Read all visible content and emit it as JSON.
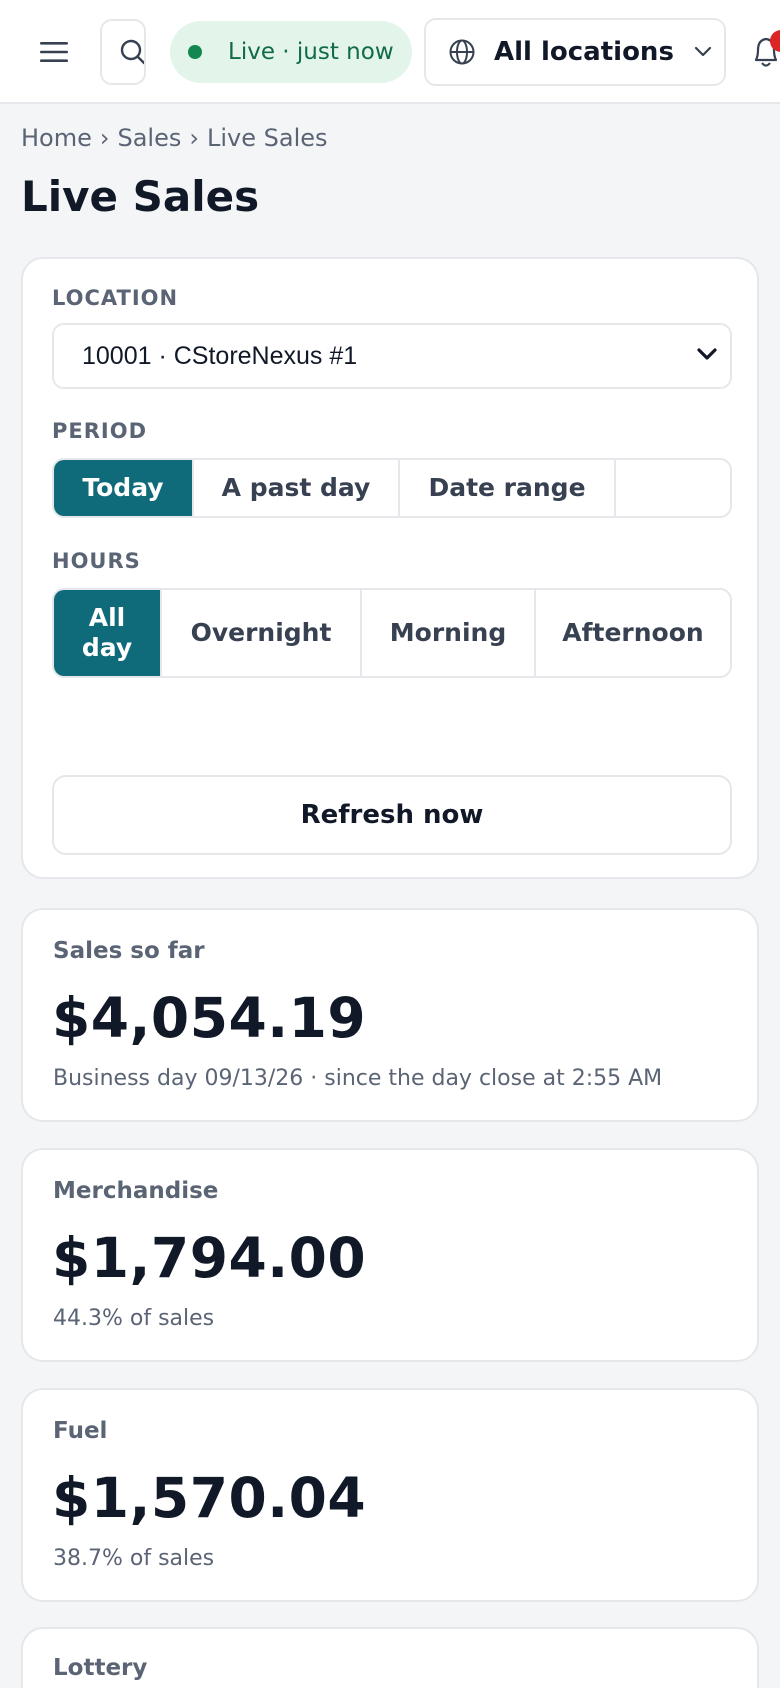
{
  "header": {
    "live_status": "Live · just now",
    "location_selector": "All locations"
  },
  "breadcrumb": [
    "Home",
    "Sales",
    "Live Sales"
  ],
  "page_title": "Live Sales",
  "filters": {
    "location_label": "LOCATION",
    "location_value": "10001 · CStoreNexus #1",
    "period_label": "PERIOD",
    "period_options": [
      "Today",
      "A past day",
      "Date range"
    ],
    "period_selected": "Today",
    "hours_label": "HOURS",
    "hours_options": [
      "All day",
      "Overnight",
      "Morning",
      "Afternoon"
    ],
    "hours_selected": "All day",
    "refresh_label": "Refresh now"
  },
  "metrics": [
    {
      "label": "Sales so far",
      "value": "$4,054.19",
      "sub": "Business day 09/13/26 · since the day close at 2:55 AM"
    },
    {
      "label": "Merchandise",
      "value": "$1,794.00",
      "sub": "44.3% of sales"
    },
    {
      "label": "Fuel",
      "value": "$1,570.04",
      "sub": "38.7% of sales"
    },
    {
      "label": "Lottery"
    }
  ],
  "colors": {
    "accent": "#0f6b7a",
    "live_bg": "#e3f4ea",
    "live_text": "#116b45",
    "badge": "#dc2626"
  }
}
